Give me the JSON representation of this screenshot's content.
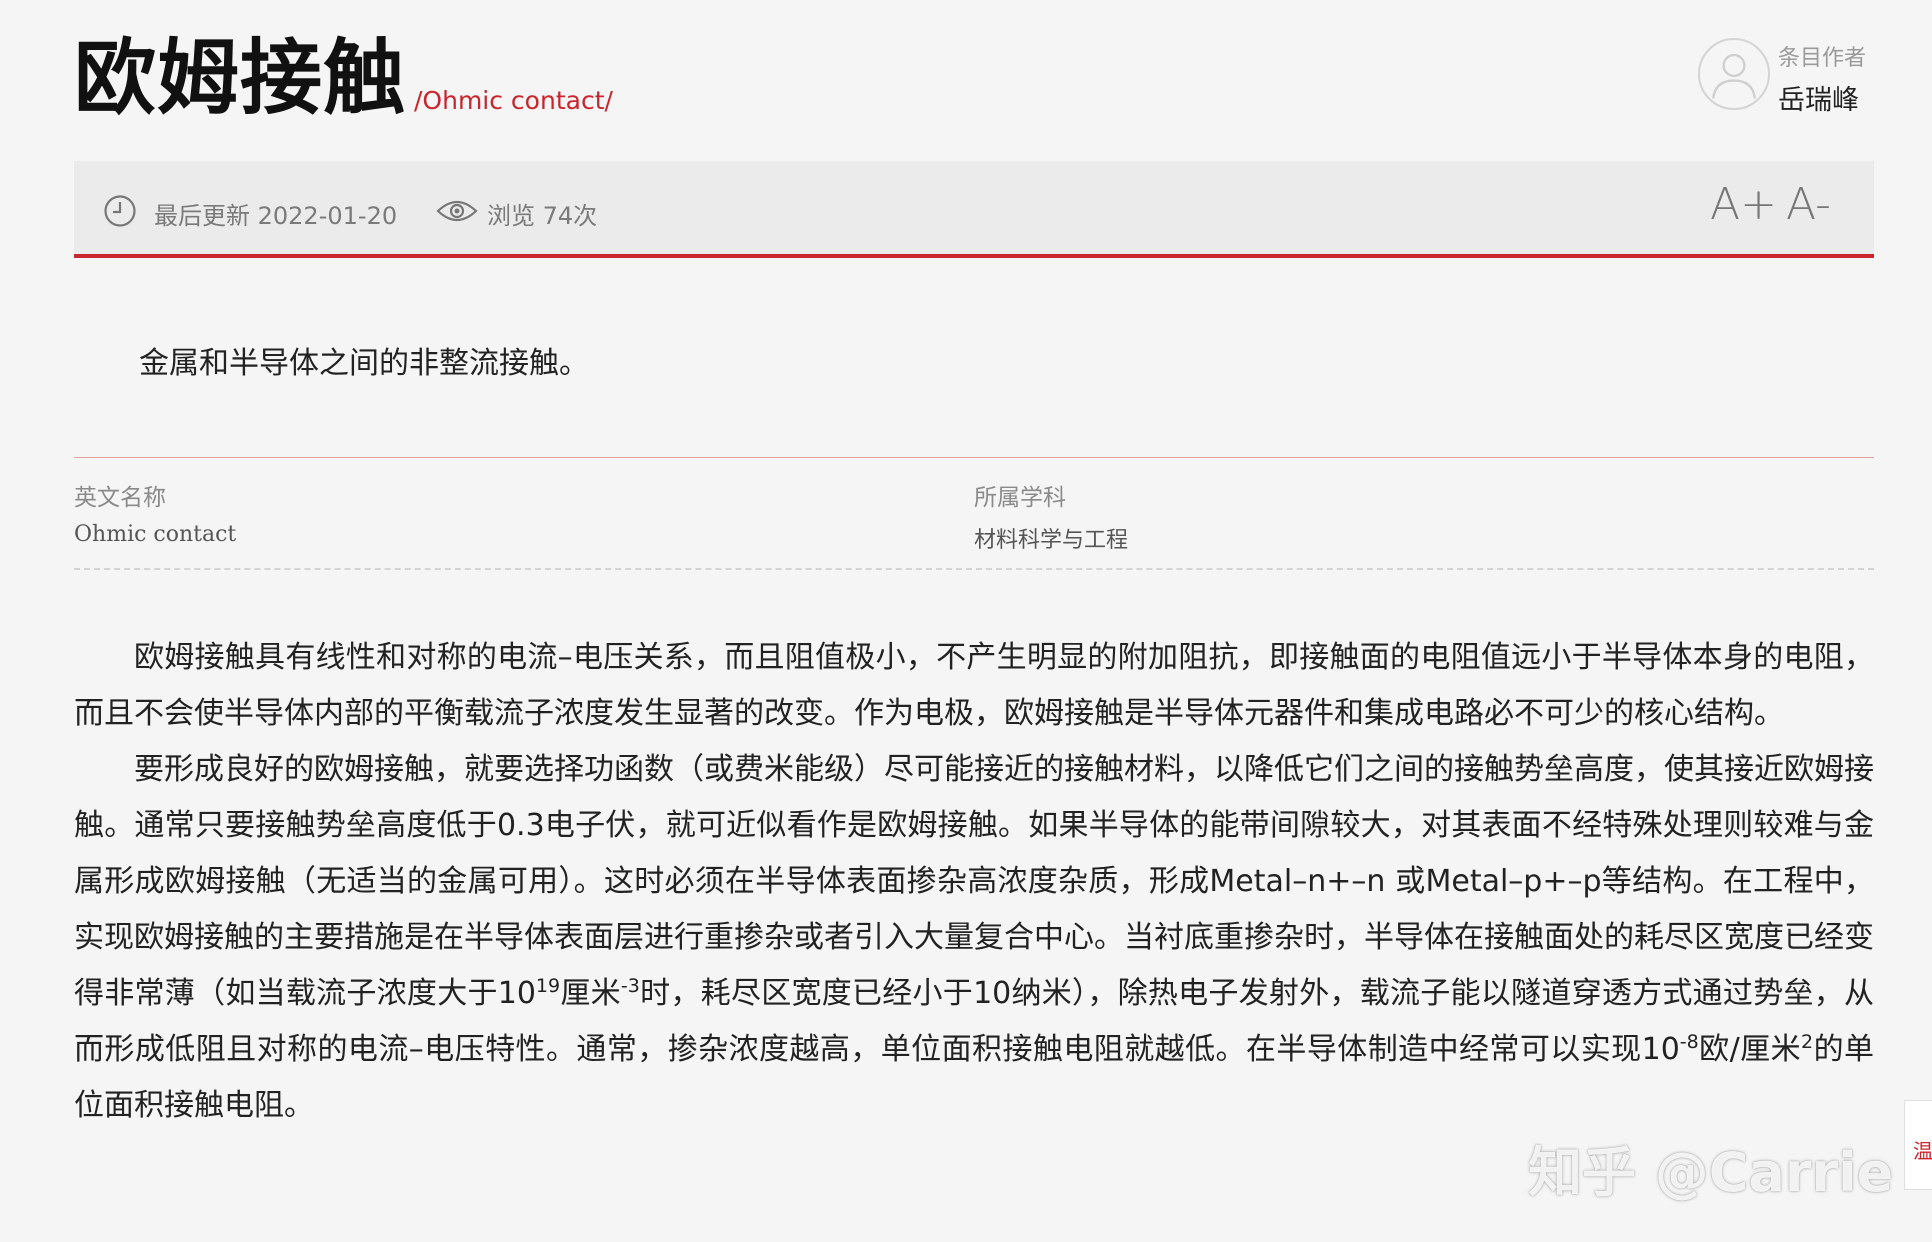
{
  "header": {
    "title": "欧姆接触",
    "subtitle": "/Ohmic contact/",
    "author_label": "条目作者",
    "author_name": "岳瑞峰"
  },
  "toolbar": {
    "updated_label": "最后更新 2022-01-20",
    "views_label": "浏览 74次",
    "font_increase": "A+",
    "font_decrease": "A-"
  },
  "summary": "金属和半导体之间的非整流接触。",
  "info": {
    "english_name_label": "英文名称",
    "english_name_value": "Ohmic contact",
    "discipline_label": "所属学科",
    "discipline_value": "材料科学与工程"
  },
  "body": {
    "p1": "欧姆接触具有线性和对称的电流–电压关系，而且阻值极小，不产生明显的附加阻抗，即接触面的电阻值远小于半导体本身的电阻，而且不会使半导体内部的平衡载流子浓度发生显著的改变。作为电极，欧姆接触是半导体元器件和集成电路必不可少的核心结构。",
    "p2_a": "要形成良好的欧姆接触，就要选择功函数（或费米能级）尽可能接近的接触材料，以降低它们之间的接触势垒高度，使其接近欧姆接触。通常只要接触势垒高度低于0.3电子伏，就可近似看作是欧姆接触。如果半导体的能带间隙较大，对其表面不经特殊处理则较难与金属形成欧姆接触（无适当的金属可用）。这时必须在半导体表面掺杂高浓度杂质，形成Metal–n+–n 或Metal–p+–p等结构。在工程中，实现欧姆接触的主要措施是在半导体表面层进行重掺杂或者引入大量复合中心。当衬底重掺杂时，半导体在接触面处的耗尽区宽度已经变得非常薄（如当载流子浓度大于10",
    "p2_sup1": "19",
    "p2_b": "厘米",
    "p2_sup2": "-3",
    "p2_c": "时，耗尽区宽度已经小于10纳米），除热电子发射外，载流子能以隧道穿透方式通过势垒，从而形成低阻且对称的电流–电压特性。通常，掺杂浓度越高，单位面积接触电阻就越低。在半导体制造中经常可以实现10",
    "p2_sup3": "-8",
    "p2_d": "欧/厘米",
    "p2_sup4": "2",
    "p2_e": "的单位面积接触电阻。"
  },
  "watermark": "知乎 @Carrie",
  "float_tab_label": "温",
  "colors": {
    "accent": "#c8262c",
    "background": "#f5f5f6",
    "toolbar": "#ebebec"
  },
  "icons": [
    "user-avatar-icon",
    "clock-icon",
    "eye-icon"
  ]
}
